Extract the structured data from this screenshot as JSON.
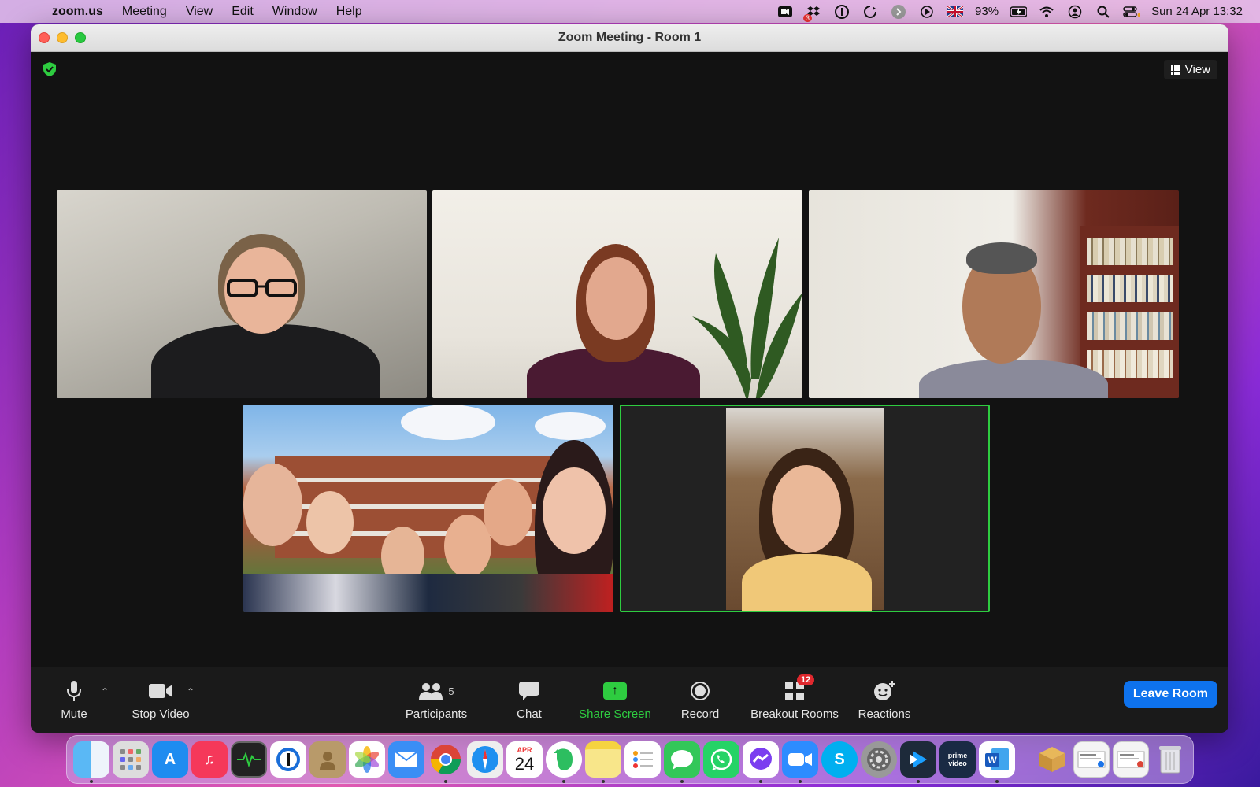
{
  "menubar": {
    "app_name": "zoom.us",
    "menus": [
      "Meeting",
      "View",
      "Edit",
      "Window",
      "Help"
    ],
    "status": {
      "dropbox_badge": "3",
      "battery": "93%",
      "datetime": "Sun 24 Apr  13:32"
    }
  },
  "window": {
    "title": "Zoom Meeting - Room 1",
    "view_label": "View"
  },
  "toolbar": {
    "mute_label": "Mute",
    "video_label": "Stop Video",
    "participants_label": "Participants",
    "participants_count": "5",
    "chat_label": "Chat",
    "share_label": "Share Screen",
    "record_label": "Record",
    "breakout_label": "Breakout Rooms",
    "breakout_badge": "12",
    "reactions_label": "Reactions",
    "leave_label": "Leave Room"
  },
  "dock": {
    "calendar_month": "APR",
    "calendar_day": "24",
    "prime_label": "prime video"
  },
  "colors": {
    "share_green": "#2ecc40",
    "leave_blue": "#0e72ed",
    "active_speaker_border": "#2ecc40"
  }
}
